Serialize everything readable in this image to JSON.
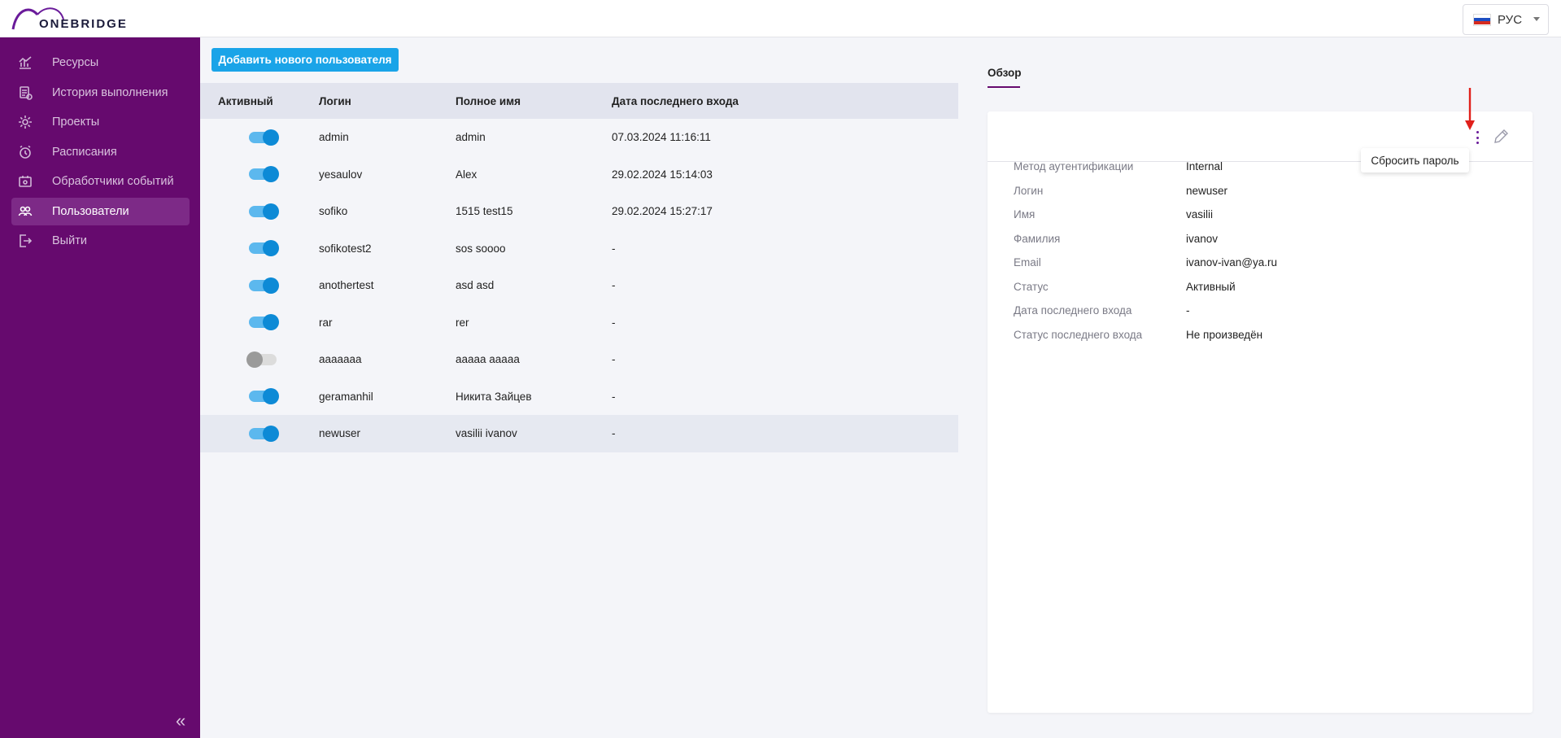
{
  "app": {
    "logo_text": "ONEBRIDGE",
    "language": "РУС"
  },
  "sidebar": {
    "items": [
      {
        "label": "Ресурсы",
        "icon": "chart-icon"
      },
      {
        "label": "История выполнения",
        "icon": "history-icon"
      },
      {
        "label": "Проекты",
        "icon": "gear-icon"
      },
      {
        "label": "Расписания",
        "icon": "clock-icon"
      },
      {
        "label": "Обработчики событий",
        "icon": "event-icon"
      },
      {
        "label": "Пользователи",
        "icon": "users-icon",
        "active": true
      },
      {
        "label": "Выйти",
        "icon": "logout-icon"
      }
    ],
    "collapse_label": "«"
  },
  "main": {
    "add_button_label": "Добавить нового пользователя",
    "table": {
      "headers": [
        "Активный",
        "Логин",
        "Полное имя",
        "Дата последнего входа"
      ],
      "rows": [
        {
          "active": true,
          "login": "admin",
          "name": "admin",
          "date": "07.03.2024 11:16:11"
        },
        {
          "active": true,
          "login": "yesaulov",
          "name": "Alex",
          "date": "29.02.2024 15:14:03"
        },
        {
          "active": true,
          "login": "sofiko",
          "name": "1515 test15",
          "date": "29.02.2024 15:27:17"
        },
        {
          "active": true,
          "login": "sofikotest2",
          "name": "sos soooo",
          "date": "-"
        },
        {
          "active": true,
          "login": "anothertest",
          "name": "asd asd",
          "date": "-"
        },
        {
          "active": true,
          "login": "rar",
          "name": "rer",
          "date": "-"
        },
        {
          "active": false,
          "login": "aaaaaaa",
          "name": "aaaaa aaaaa",
          "date": "-"
        },
        {
          "active": true,
          "login": "geramanhil",
          "name": "Никита Зайцев",
          "date": "-"
        },
        {
          "active": true,
          "login": "newuser",
          "name": "vasilii ivanov",
          "date": "-",
          "selected": true
        }
      ]
    }
  },
  "details": {
    "tab_label": "Обзор",
    "tooltip": "Сбросить пароль",
    "fields": [
      {
        "label": "Метод аутентификации",
        "value": "Internal"
      },
      {
        "label": "Логин",
        "value": "newuser"
      },
      {
        "label": "Имя",
        "value": "vasilii"
      },
      {
        "label": "Фамилия",
        "value": "ivanov"
      },
      {
        "label": "Email",
        "value": "ivanov-ivan@ya.ru"
      },
      {
        "label": "Статус",
        "value": "Активный"
      },
      {
        "label": "Дата последнего входа",
        "value": "-"
      },
      {
        "label": "Статус последнего входа",
        "value": "Не произведён"
      }
    ]
  },
  "colors": {
    "sidebar_bg": "#660a6e",
    "accent": "#1aa4e8",
    "arrow": "#e0201b"
  }
}
